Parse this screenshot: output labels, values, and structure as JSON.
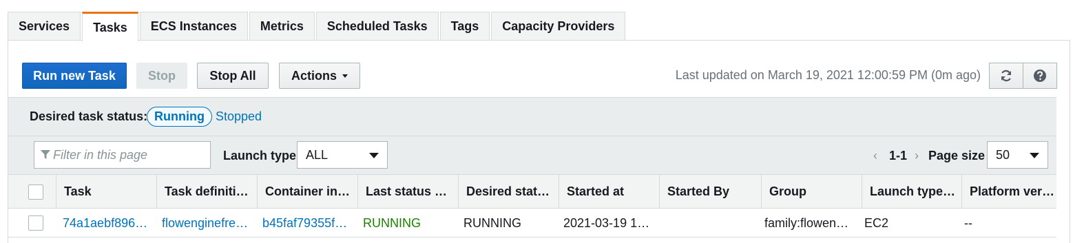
{
  "tabs": [
    {
      "label": "Services"
    },
    {
      "label": "Tasks"
    },
    {
      "label": "ECS Instances"
    },
    {
      "label": "Metrics"
    },
    {
      "label": "Scheduled Tasks"
    },
    {
      "label": "Tags"
    },
    {
      "label": "Capacity Providers"
    }
  ],
  "active_tab": "Tasks",
  "toolbar": {
    "run_new_task": "Run new Task",
    "stop": "Stop",
    "stop_all": "Stop All",
    "actions": "Actions",
    "last_updated": "Last updated on March 19, 2021 12:00:59 PM (0m ago)"
  },
  "status_filter": {
    "label": "Desired task status:",
    "running": "Running",
    "stopped": "Stopped"
  },
  "filter": {
    "placeholder": "Filter in this page",
    "launch_type_label": "Launch type",
    "launch_type_value": "ALL",
    "pagination": "1-1",
    "page_size_label": "Page size",
    "page_size_value": "50"
  },
  "table": {
    "columns": [
      "Task",
      "Task definiti…",
      "Container in…",
      "Last status …",
      "Desired stat…",
      "Started at",
      "Started By",
      "Group",
      "Launch type…",
      "Platform ver…"
    ],
    "rows": [
      {
        "task": "74a1aebf896…",
        "task_definition": "flowenginefre…",
        "container_instance": "b45faf79355f…",
        "last_status": "RUNNING",
        "desired_status": "RUNNING",
        "started_at": "2021-03-19 1…",
        "started_by": "",
        "group": "family:flowen…",
        "launch_type": "EC2",
        "platform_version": "--"
      }
    ]
  },
  "colors": {
    "accent": "#ec7211",
    "primary": "#1166bb",
    "link": "#0073bb",
    "running": "#1d8102"
  }
}
